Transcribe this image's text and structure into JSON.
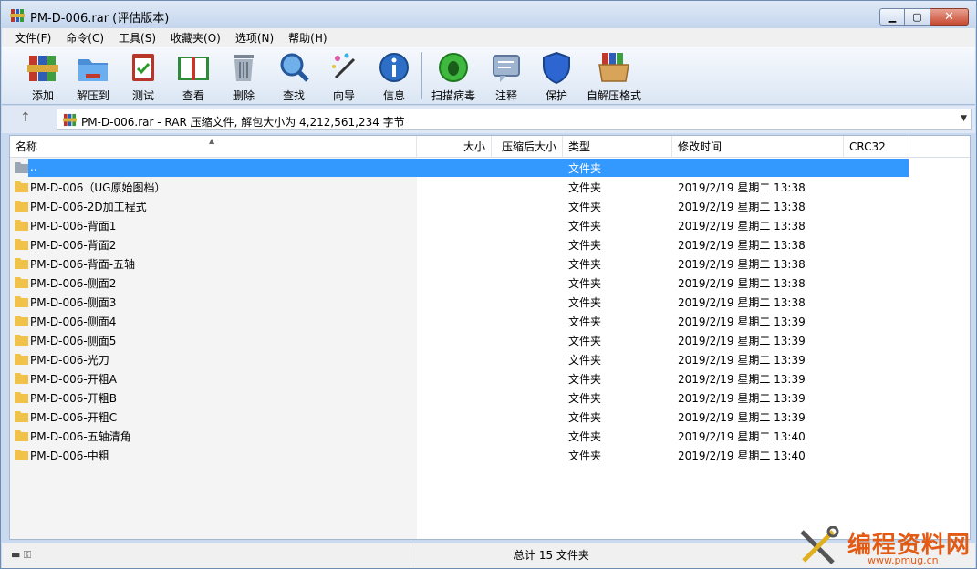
{
  "window": {
    "title": "PM-D-006.rar (评估版本)"
  },
  "menu": [
    "文件(F)",
    "命令(C)",
    "工具(S)",
    "收藏夹(O)",
    "选项(N)",
    "帮助(H)"
  ],
  "toolbar": {
    "buttons": [
      {
        "label": "添加",
        "icon": "add-archive-icon"
      },
      {
        "label": "解压到",
        "icon": "extract-folder-icon"
      },
      {
        "label": "测试",
        "icon": "test-clipboard-icon"
      },
      {
        "label": "查看",
        "icon": "view-book-icon"
      },
      {
        "label": "删除",
        "icon": "trash-icon"
      },
      {
        "label": "查找",
        "icon": "magnifier-icon"
      },
      {
        "label": "向导",
        "icon": "wizard-wand-icon"
      },
      {
        "label": "信息",
        "icon": "info-icon"
      },
      {
        "label": "扫描病毒",
        "icon": "virus-scan-icon"
      },
      {
        "label": "注释",
        "icon": "comment-icon"
      },
      {
        "label": "保护",
        "icon": "shield-icon"
      },
      {
        "label": "自解压格式",
        "icon": "sfx-box-icon"
      }
    ]
  },
  "address": {
    "text": "PM-D-006.rar - RAR 压缩文件, 解包大小为 4,212,561,234 字节"
  },
  "columns": [
    "名称",
    "大小",
    "压缩后大小",
    "类型",
    "修改时间",
    "CRC32"
  ],
  "rows": [
    {
      "name": "..",
      "type": "文件夹",
      "modified": ""
    },
    {
      "name": "PM-D-006（UG原始图档）",
      "type": "文件夹",
      "modified": "2019/2/19 星期二 13:38"
    },
    {
      "name": "PM-D-006-2D加工程式",
      "type": "文件夹",
      "modified": "2019/2/19 星期二 13:38"
    },
    {
      "name": "PM-D-006-背面1",
      "type": "文件夹",
      "modified": "2019/2/19 星期二 13:38"
    },
    {
      "name": "PM-D-006-背面2",
      "type": "文件夹",
      "modified": "2019/2/19 星期二 13:38"
    },
    {
      "name": "PM-D-006-背面-五轴",
      "type": "文件夹",
      "modified": "2019/2/19 星期二 13:38"
    },
    {
      "name": "PM-D-006-侧面2",
      "type": "文件夹",
      "modified": "2019/2/19 星期二 13:38"
    },
    {
      "name": "PM-D-006-侧面3",
      "type": "文件夹",
      "modified": "2019/2/19 星期二 13:38"
    },
    {
      "name": "PM-D-006-侧面4",
      "type": "文件夹",
      "modified": "2019/2/19 星期二 13:39"
    },
    {
      "name": "PM-D-006-侧面5",
      "type": "文件夹",
      "modified": "2019/2/19 星期二 13:39"
    },
    {
      "name": "PM-D-006-光刀",
      "type": "文件夹",
      "modified": "2019/2/19 星期二 13:39"
    },
    {
      "name": "PM-D-006-开粗A",
      "type": "文件夹",
      "modified": "2019/2/19 星期二 13:39"
    },
    {
      "name": "PM-D-006-开粗B",
      "type": "文件夹",
      "modified": "2019/2/19 星期二 13:39"
    },
    {
      "name": "PM-D-006-开粗C",
      "type": "文件夹",
      "modified": "2019/2/19 星期二 13:39"
    },
    {
      "name": "PM-D-006-五轴清角",
      "type": "文件夹",
      "modified": "2019/2/19 星期二 13:40"
    },
    {
      "name": "PM-D-006-中粗",
      "type": "文件夹",
      "modified": "2019/2/19 星期二 13:40"
    }
  ],
  "status": {
    "summary": "总计 15 文件夹"
  },
  "watermark": {
    "text": "编程资料网",
    "url": "www.pmug.cn"
  },
  "colors": {
    "selection": "#3399ff",
    "folder": "#f0c24a",
    "watermark": "#e25a14"
  }
}
